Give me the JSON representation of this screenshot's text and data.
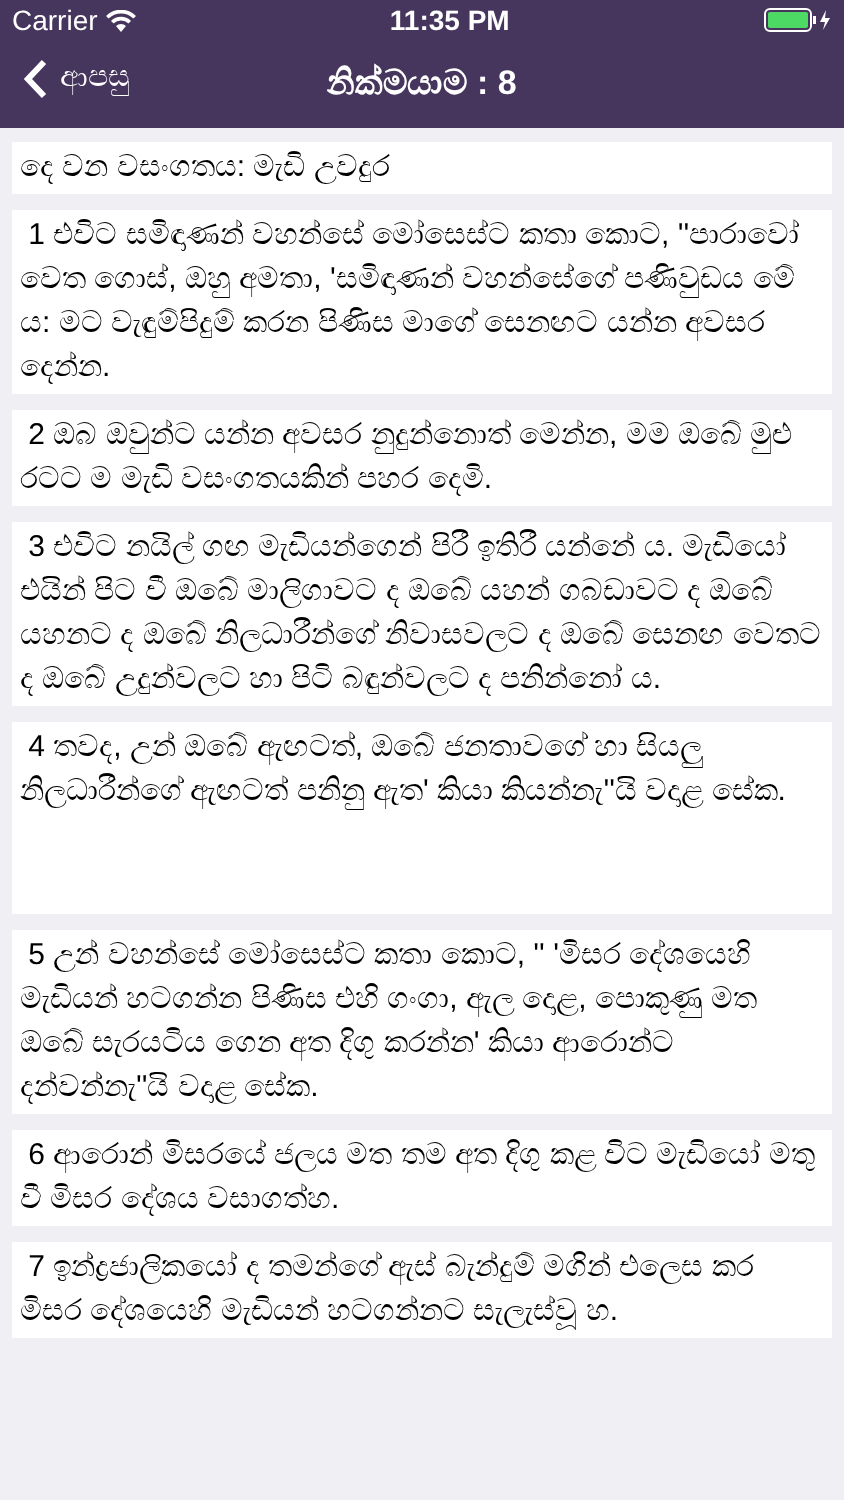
{
  "status_bar": {
    "carrier": "Carrier",
    "time": "11:35 PM"
  },
  "nav": {
    "back": "ආපසු",
    "title": "නික්මයාම : 8"
  },
  "verses": [
    {
      "text": "දෙ වන වසංගතය: මැඩි උවදුර"
    },
    {
      "text": " 1 එවිට සමිඳාණන් වහන්සේ මෝසෙස්ට කතා කොට, ''පාරාවෝ වෙත ගොස්, ඔහු අමතා, 'සමිඳාණන් වහන්සේගේ පණිවුඩය මේ ය: මට වැඳුම්පිදුම් කරන පිණිස මාගේ සෙනඟට යන්න අවසර දෙන්න."
    },
    {
      "text": " 2 ඔබ ඔවුන්ට යන්න අවසර නුදුන්නොත් මෙන්න, මම ඔබේ මුළු රටට ම මැඩි වසංගතයකින් පහර දෙමි."
    },
    {
      "text": " 3 එවිට නයිල් ගඟ මැඩියන්ගෙන් පිරී ඉතිරී යන්නේ ය. මැඩියෝ එයින් පිට වී ඔබේ මාලිගාවට ද ඔබේ යහන් ගබඩාවට ද ඔබේ යහනට ද ඔබේ නිලධාරීන්ගේ නිවාසවලට ද ඔබේ සෙනඟ වෙතට ද ඔබේ උදුන්වලට හා පිටි බඳුන්වලට ද පනින්නෝ ය."
    },
    {
      "text": " 4 තවද, උන් ඔබේ ඇඟටත්, ඔබේ ජනතාවගේ හා සියලු නිලධාරීන්ගේ ඇඟටත් පනිනු ඇත' කියා කියන්නැ''යි වදාළ සේක."
    },
    {
      "text": " 5 උන් වහන්සේ මෝසෙස්ට කතා කොට, '' 'මිසර දේශයෙහි මැඩියන් හටගන්න පිණිස එහි ගංගා, ඇල දොළ, පොකුණු මත ඔබේ සැරයටිය ගෙන අත දිගු කරන්න' කියා ආරොන්ට දන්වන්නැ''යි වදාළ සේක."
    },
    {
      "text": " 6 ආරොන් මිසරයේ ජලය මත තම අත දිගු කළ විට මැඩියෝ මතු වී මිසර දේශය වසාගත්හ."
    },
    {
      "text": " 7 ඉන්ද්‍රජාලිකයෝ ද තමන්ගේ ඇස් බැන්දුම් මගින් එලෙස කර මිසර දේශයෙහි මැඩියන් හටගන්නට සැලැස්වූ හ."
    }
  ]
}
